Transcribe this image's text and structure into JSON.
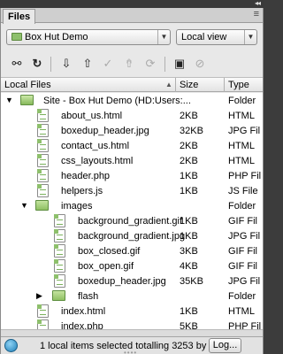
{
  "panel": {
    "tab_label": "Files",
    "collapse_glyph": "◂◂",
    "menu_glyph": "≡"
  },
  "selectors": {
    "site": "Box Hut Demo",
    "view": "Local view"
  },
  "toolbar": {
    "icons": [
      "connect-icon",
      "refresh-icon",
      "get-icon",
      "put-icon",
      "checkout-icon",
      "checkin-icon",
      "sync-icon",
      "expand-icon",
      "disconnect-icon"
    ]
  },
  "columns": {
    "name": "Local Files",
    "size": "Size",
    "type": "Type"
  },
  "rows": [
    {
      "name": "Site - Box Hut Demo (HD:Users:...",
      "size": "",
      "type": "Folder",
      "kind": "site"
    },
    {
      "name": "about_us.html",
      "size": "2KB",
      "type": "HTML",
      "kind": "file"
    },
    {
      "name": "boxedup_header.jpg",
      "size": "32KB",
      "type": "JPG Fil",
      "kind": "file"
    },
    {
      "name": "contact_us.html",
      "size": "2KB",
      "type": "HTML",
      "kind": "file"
    },
    {
      "name": "css_layouts.html",
      "size": "2KB",
      "type": "HTML",
      "kind": "file"
    },
    {
      "name": "header.php",
      "size": "1KB",
      "type": "PHP Fil",
      "kind": "file"
    },
    {
      "name": "helpers.js",
      "size": "1KB",
      "type": "JS File",
      "kind": "file"
    },
    {
      "name": "images",
      "size": "",
      "type": "Folder",
      "kind": "folder"
    },
    {
      "name": "background_gradient.gif",
      "size": "1KB",
      "type": "GIF Fil",
      "kind": "file"
    },
    {
      "name": "background_gradient.jpg",
      "size": "1KB",
      "type": "JPG Fil",
      "kind": "file"
    },
    {
      "name": "box_closed.gif",
      "size": "3KB",
      "type": "GIF Fil",
      "kind": "file"
    },
    {
      "name": "box_open.gif",
      "size": "4KB",
      "type": "GIF Fil",
      "kind": "file"
    },
    {
      "name": "boxedup_header.jpg",
      "size": "35KB",
      "type": "JPG Fil",
      "kind": "file"
    },
    {
      "name": "flash",
      "size": "",
      "type": "Folder",
      "kind": "folder"
    },
    {
      "name": "index.html",
      "size": "1KB",
      "type": "HTML",
      "kind": "file"
    },
    {
      "name": "index.php",
      "size": "5KB",
      "type": "PHP Fil",
      "kind": "file"
    }
  ],
  "status": {
    "message": "1 local items selected totalling 3253 by",
    "log_button": "Log..."
  }
}
